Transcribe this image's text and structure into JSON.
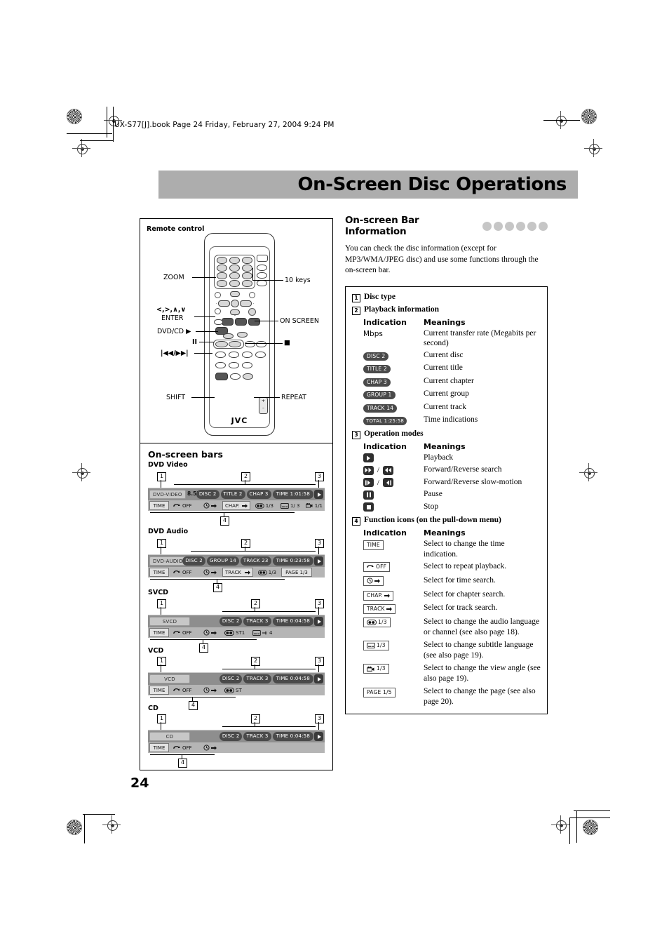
{
  "page": {
    "file_line": "UX-S77[J].book  Page 24  Friday, February 27, 2004  9:24 PM",
    "title": "On-Screen Disc Operations",
    "page_number": "24"
  },
  "remote_panel": {
    "label": "Remote control",
    "brand": "JVC",
    "callouts": {
      "zoom": "ZOOM",
      "ten_keys": "10 keys",
      "arrows": "<,>,∧,∨",
      "enter": "ENTER",
      "on_screen": "ON SCREEN",
      "dvd_cd_play": "DVD/CD ▶",
      "pause": "II",
      "stop": "■",
      "skip": "|◀◀/▶▶|",
      "shift": "SHIFT",
      "repeat": "REPEAT"
    },
    "plus": "+",
    "minus": "–"
  },
  "onscreen_bars": {
    "heading": "On-screen bars",
    "callout_numbers": {
      "n1": "1",
      "n2": "2",
      "n3": "3",
      "n4": "4"
    },
    "bars": [
      {
        "title": "DVD Video",
        "disc_tag": "DVD-VIDEO",
        "mbps": "8.5Mbps",
        "pills": [
          "DISC 2",
          "TITLE 2",
          "CHAP 3"
        ],
        "time_pill": "TIME  1:01:58",
        "functions": [
          "TIME",
          "OFF",
          "",
          "CHAP.",
          "1/3",
          "1/ 3",
          "1/1"
        ]
      },
      {
        "title": "DVD Audio",
        "disc_tag": "DVD-AUDIO",
        "mbps": "",
        "pills": [
          "DISC 2",
          "GROUP 14",
          "TRACK 23"
        ],
        "time_pill": "TIME  0:23:58",
        "functions": [
          "TIME",
          "OFF",
          "",
          "TRACK",
          "1/3",
          "PAGE 1/3"
        ]
      },
      {
        "title": "SVCD",
        "disc_tag": "SVCD",
        "mbps": "",
        "pills": [
          "DISC 2",
          "TRACK 3"
        ],
        "time_pill": "TIME     0:04:58",
        "functions": [
          "TIME",
          "OFF",
          "",
          "ST1",
          "4"
        ]
      },
      {
        "title": "VCD",
        "disc_tag": "VCD",
        "mbps": "",
        "pills": [
          "DISC 2",
          "TRACK 3"
        ],
        "time_pill": "TIME     0:04:58",
        "functions": [
          "TIME",
          "OFF",
          "",
          "ST"
        ]
      },
      {
        "title": "CD",
        "disc_tag": "CD",
        "mbps": "",
        "pills": [
          "DISC 2",
          "TRACK 3"
        ],
        "time_pill": "TIME     0:04:58",
        "functions": [
          "TIME",
          "OFF",
          ""
        ]
      }
    ]
  },
  "info": {
    "heading": "On-screen Bar Information",
    "intro": "You can check the disc information (except for MP3/WMA/JPEG disc) and use some functions through the on-screen bar.",
    "s1": {
      "num": "1",
      "title": "Disc type"
    },
    "s2": {
      "num": "2",
      "title": "Playback information",
      "col1": "Indication",
      "col2": "Meanings",
      "rows": [
        {
          "ind": "Mbps",
          "kind": "plain",
          "mean": "Current transfer rate (Megabits per second)"
        },
        {
          "ind": "DISC 2",
          "kind": "dark",
          "mean": "Current disc"
        },
        {
          "ind": "TITLE  2",
          "kind": "dark",
          "mean": "Current title"
        },
        {
          "ind": "CHAP  3",
          "kind": "dark",
          "mean": "Current chapter"
        },
        {
          "ind": "GROUP 1",
          "kind": "dark",
          "mean": "Current group"
        },
        {
          "ind": "TRACK 14",
          "kind": "dark",
          "mean": "Current track"
        },
        {
          "ind": "TOTAL 1:25:58",
          "kind": "dark",
          "mean": "Time indications"
        }
      ]
    },
    "s3": {
      "num": "3",
      "title": "Operation modes",
      "col1": "Indication",
      "col2": "Meanings",
      "rows": [
        {
          "icons": [
            "play"
          ],
          "mean": "Playback"
        },
        {
          "icons": [
            "ffwd",
            "frew"
          ],
          "mean": "Forward/Reverse search"
        },
        {
          "icons": [
            "slowf",
            "slowr"
          ],
          "mean": "Forward/Reverse slow-motion"
        },
        {
          "icons": [
            "pause"
          ],
          "mean": "Pause"
        },
        {
          "icons": [
            "stop"
          ],
          "mean": "Stop"
        }
      ]
    },
    "s4": {
      "num": "4",
      "title": "Function icons (on the pull-down menu)",
      "col1": "Indication",
      "col2": "Meanings",
      "rows": [
        {
          "ind": "TIME",
          "icon": "",
          "mean": "Select to change the time indication."
        },
        {
          "ind": "OFF",
          "icon": "repeat",
          "mean": "Select to repeat playback."
        },
        {
          "ind": "",
          "icon": "clock-arrow",
          "mean": "Select for time search."
        },
        {
          "ind": "CHAP.",
          "icon": "arrow",
          "mean": "Select for chapter search."
        },
        {
          "ind": "TRACK",
          "icon": "arrow",
          "mean": "Select for track search."
        },
        {
          "ind": "1/3",
          "icon": "audio",
          "mean": "Select to change the audio language or channel (see also page 18)."
        },
        {
          "ind": "1/3",
          "icon": "subtitle",
          "mean": "Select to change subtitle language (see also page 19)."
        },
        {
          "ind": "1/3",
          "icon": "angle",
          "mean": "Select to change the view angle (see also page 19)."
        },
        {
          "ind": "PAGE 1/5",
          "icon": "",
          "mean": "Select to change the page (see also page 20)."
        }
      ]
    }
  },
  "colors": {
    "banner": "#adadad",
    "bar_row1": "#8e8e8e",
    "bar_row2": "#b5b5b5",
    "pill": "#4a4a4a"
  }
}
